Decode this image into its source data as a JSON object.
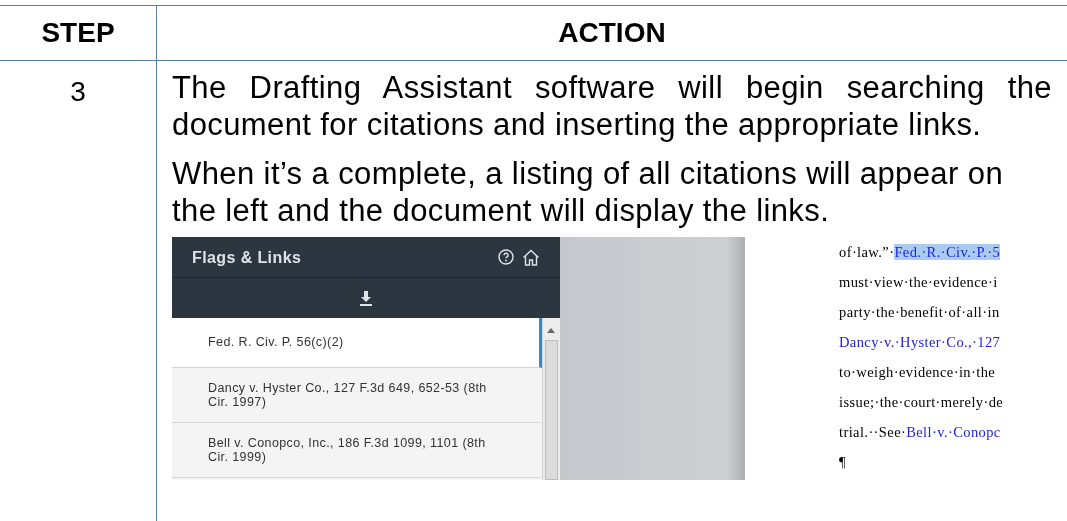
{
  "table": {
    "columns": [
      "STEP",
      "ACTION"
    ],
    "rows": [
      {
        "step": "3",
        "paragraphs": [
          "The Drafting Assistant software will begin searching the document for citations and inserting the appropriate links.",
          "When it’s a complete, a listing of all citations will appear on the left and the document will display the links."
        ],
        "screenshot": {
          "panel": {
            "title": "Flags & Links",
            "citations": [
              {
                "text": "Fed. R. Civ. P. 56(c)(2)",
                "selected": true
              },
              {
                "text": "Dancy v. Hyster Co., 127 F.3d 649, 652-53 (8th Cir. 1997)",
                "selected": false
              },
              {
                "text": "Bell v. Conopco, Inc., 186 F.3d 1099, 1101 (8th Cir. 1999)",
                "selected": false
              }
            ]
          },
          "document_lines": [
            {
              "segments": [
                {
                  "text": "of·law.”·",
                  "kind": "plain",
                  "selected": false
                },
                {
                  "text": "Fed.·R.·Civ.·P.·5",
                  "kind": "link",
                  "selected": true
                }
              ]
            },
            {
              "segments": [
                {
                  "text": "must·view·the·evidence·i",
                  "kind": "plain",
                  "selected": false
                }
              ]
            },
            {
              "segments": [
                {
                  "text": "party·the·benefit·of·all·in",
                  "kind": "plain",
                  "selected": false
                }
              ]
            },
            {
              "segments": [
                {
                  "text": "Dancy·v.·Hyster·Co.,·127",
                  "kind": "link",
                  "selected": false
                }
              ]
            },
            {
              "segments": [
                {
                  "text": "to·weigh·evidence·in·the",
                  "kind": "plain",
                  "selected": false
                }
              ]
            },
            {
              "segments": [
                {
                  "text": "issue;·the·court·merely·de",
                  "kind": "plain",
                  "selected": false
                }
              ]
            },
            {
              "segments": [
                {
                  "text": "trial.··See·",
                  "kind": "plain",
                  "selected": false
                },
                {
                  "text": "Bell·v.·Conopc",
                  "kind": "link",
                  "selected": false
                }
              ]
            },
            {
              "segments": [
                {
                  "text": "¶",
                  "kind": "plain",
                  "selected": false
                }
              ]
            }
          ]
        }
      }
    ]
  }
}
